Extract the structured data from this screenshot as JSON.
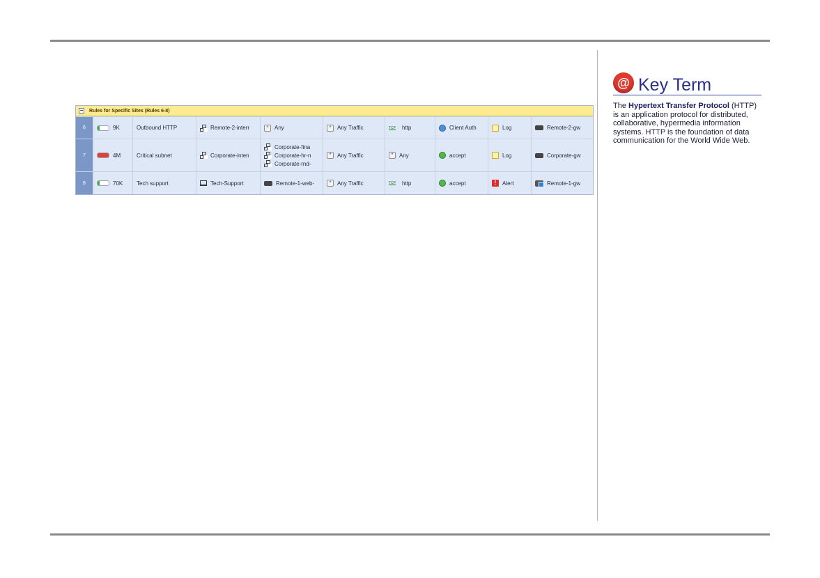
{
  "section": {
    "title": "Rules for Specific Sites   (Rules 6-8)"
  },
  "rows": [
    {
      "num": "6",
      "hits": "9K",
      "hits_level": 0.2,
      "hits_color": "#3cb34a",
      "name": "Outbound HTTP",
      "source": "Remote-2-interr",
      "destination": [
        "Any"
      ],
      "vpn": "Any Traffic",
      "service": "http",
      "action": "Client Auth",
      "track": "Log",
      "install_on": "Remote-2-gw"
    },
    {
      "num": "7",
      "hits": "4M",
      "hits_level": 1.0,
      "hits_color": "#e0403a",
      "name": "Critical subnet",
      "source": "Corporate-inten",
      "destination": [
        "Corporate-fina",
        "Corporate-hr-n",
        "Corporate-rnd-"
      ],
      "vpn": "Any Traffic",
      "service": "Any",
      "action": "accept",
      "track": "Log",
      "install_on": "Corporate-gw"
    },
    {
      "num": "8",
      "hits": "70K",
      "hits_level": 0.2,
      "hits_color": "#3cb34a",
      "name": "Tech support",
      "source": "Tech-Support",
      "destination": [
        "Remote-1-web-"
      ],
      "vpn": "Any Traffic",
      "service": "http",
      "action": "accept",
      "track": "Alert",
      "install_on": "Remote-1-gw"
    }
  ],
  "key_term": {
    "heading": "Key Term",
    "icon": "@",
    "text_before": "The ",
    "term": "Hypertext Transfer Protocol",
    "text_after": " (HTTP) is an application protocol for distributed, collaborative, hypermedia information systems. HTTP is the foundation of data communication for the World Wide Web."
  },
  "colors": {
    "section_header": "#fdeb94",
    "row_bg": "#dfe8f6",
    "row_number": "#7b97c8",
    "key_term_accent": "#2b2f8a",
    "key_term_icon": "#e03a2f"
  }
}
